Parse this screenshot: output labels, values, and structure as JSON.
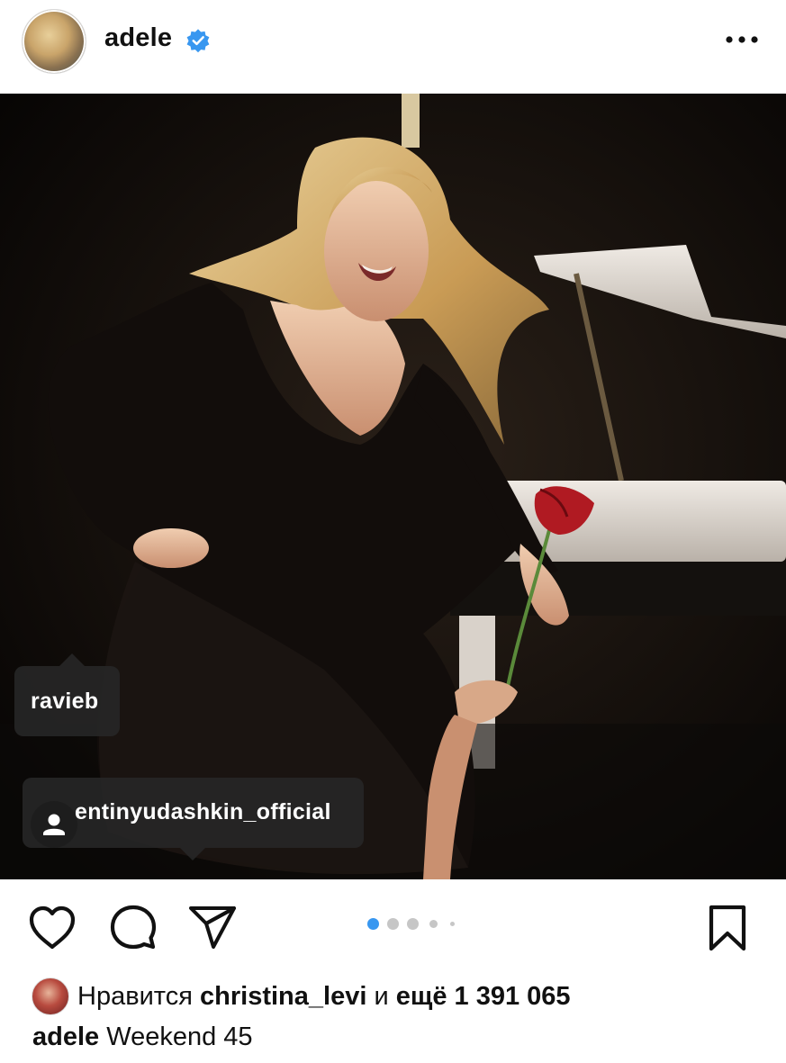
{
  "post": {
    "username": "adele",
    "verified": true,
    "more_icon": "more-horizontal-icon"
  },
  "tags": [
    {
      "username": "ravieb"
    },
    {
      "username": "valentinyudashkin_official",
      "display_text": "entinyudashkin_official"
    }
  ],
  "actions": {
    "like_icon": "heart-icon",
    "comment_icon": "comment-icon",
    "share_icon": "paper-plane-icon",
    "save_icon": "bookmark-icon"
  },
  "carousel": {
    "active_index": 1,
    "dots_visible": 5
  },
  "likes": {
    "prefix": "Нравится",
    "user": "christina_levi",
    "conjunction": "и",
    "more": "ещё 1 391 065"
  },
  "caption": {
    "username": "adele",
    "text": "Weekend 45"
  },
  "colors": {
    "verified_blue": "#3897f0",
    "active_dot": "#3897f0",
    "inactive_dot": "#c6c6c6"
  }
}
